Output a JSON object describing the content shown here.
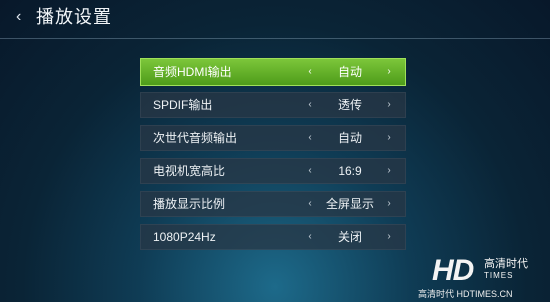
{
  "header": {
    "back_icon": "chevron-left-icon",
    "back_glyph": "‹",
    "title": "播放设置"
  },
  "settings": [
    {
      "label": "音频HDMI输出",
      "value": "自动",
      "active": true
    },
    {
      "label": "SPDIF输出",
      "value": "透传",
      "active": false
    },
    {
      "label": "次世代音频输出",
      "value": "自动",
      "active": false
    },
    {
      "label": "电视机宽高比",
      "value": "16:9",
      "active": false
    },
    {
      "label": "播放显示比例",
      "value": "全屏显示",
      "active": false
    },
    {
      "label": "1080P24Hz",
      "value": "关闭",
      "active": false
    }
  ],
  "arrows": {
    "left": "‹",
    "right": "›"
  },
  "watermark": {
    "logo": "HD",
    "brand_cn": "高清时代",
    "brand_en": "TIMES",
    "url": "高清时代 HDTIMES.CN"
  },
  "colors": {
    "active_row": "#6cb52c",
    "row_bg": "#28374a",
    "background": "#0f3c55"
  }
}
